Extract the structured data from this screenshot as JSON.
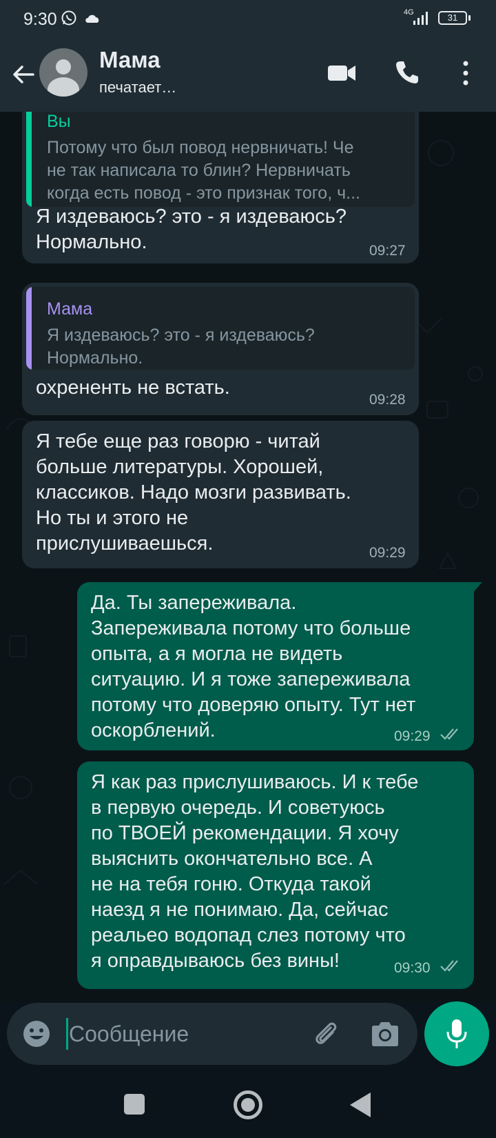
{
  "status_bar": {
    "time": "9:30",
    "network": "4G",
    "battery": "31",
    "icons": [
      "whatsapp-icon",
      "cloud-icon",
      "signal-icon",
      "battery-icon"
    ]
  },
  "header": {
    "contact_name": "Мама",
    "contact_status": "печатает…",
    "icons": [
      "back-arrow-icon",
      "avatar",
      "video-call-icon",
      "voice-call-icon",
      "more-options-icon"
    ]
  },
  "messages": [
    {
      "direction": "incoming",
      "quote_author": "Вы",
      "quote_text": "Потому что был повод нервничать! Че\nне так написала то блин? Нервничать\nкогда есть повод - это признак того, ч...",
      "text": "Я издеваюсь?  это - я издеваюсь?\nНормально.",
      "time": "09:27"
    },
    {
      "direction": "incoming",
      "quote_author": "Мама",
      "quote_text": "Я издеваюсь?  это - я издеваюсь?\nНормально.",
      "text": "охрененть не встать.",
      "time": "09:28"
    },
    {
      "direction": "incoming",
      "text": "Я тебе еще раз говорю - читай\nбольше литературы. Хорошей,\nклассиков. Надо мозги развивать.\nНо ты и этого не\nприслушиваешься.",
      "time": "09:29"
    },
    {
      "direction": "outgoing",
      "text": "Да. Ты запереживала.\nЗапереживала потому что больше\nопыта, а я могла не видеть\nситуацию. И я тоже запереживала\nпотому что доверяю опыту. Тут нет\nоскорблений.",
      "time": "09:29",
      "status": "read"
    },
    {
      "direction": "outgoing",
      "text": "Я как раз прислушиваюсь. И к тебе\nв первую очередь. И советуюсь\nпо ТВОЕЙ рекомендации. Я хочу\nвыяснить окончательно все. А\nне на тебя гоню. Откуда такой\nнаезд я не понимаю. Да, сейчас\nреальео водопад слез потому что\nя оправдываюсь без вины!",
      "time": "09:30",
      "status": "read"
    }
  ],
  "composer": {
    "placeholder": "Сообщение",
    "value": "",
    "icons": [
      "emoji-icon",
      "attach-icon",
      "camera-icon",
      "mic-icon"
    ]
  },
  "colors": {
    "header_bg": "#1f2c34",
    "chat_bg": "#0c1317",
    "incoming_bubble": "#202c33",
    "outgoing_bubble": "#005c4b",
    "accent": "#00a884",
    "quote_self": "#06cf9c",
    "quote_contact": "#a791f1"
  }
}
